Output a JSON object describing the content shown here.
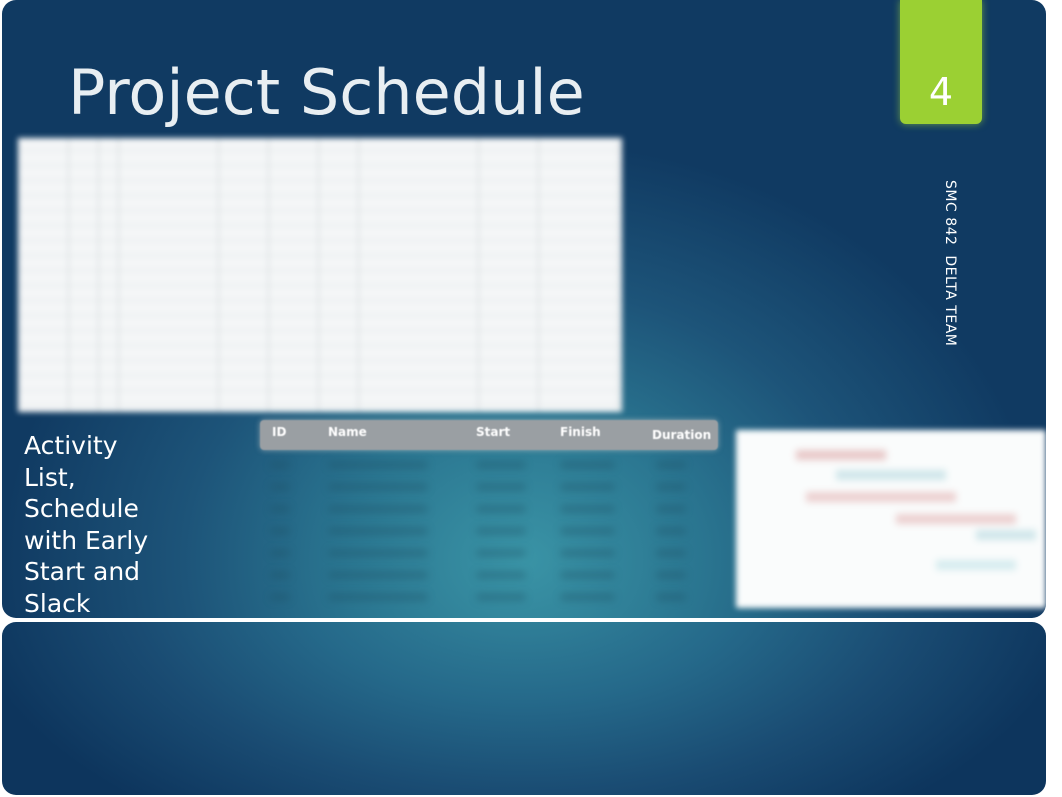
{
  "slide": {
    "title": "Project Schedule",
    "slide_number": "4",
    "side_caption": "SMC 842  DELTA TEAM",
    "caption": "Activity List, Schedule with Early Start and Slack",
    "table": {
      "headers": [
        "ID",
        "Name",
        "Start",
        "Finish",
        "Duration"
      ]
    },
    "colors": {
      "badge": "#9bd033",
      "background_center": "#3a94a6",
      "background_edge": "#103a62",
      "table_header": "#9a9fa3"
    }
  }
}
